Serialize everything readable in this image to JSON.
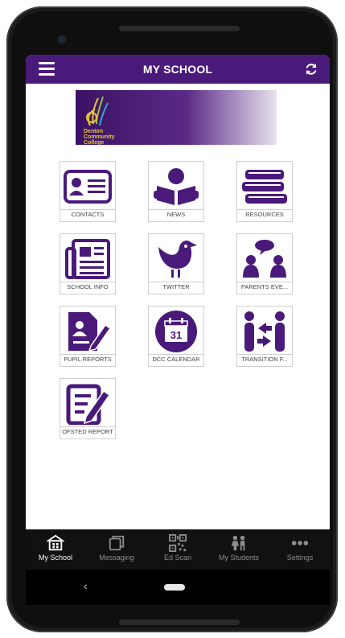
{
  "appbar": {
    "title": "MY SCHOOL"
  },
  "logo": {
    "school_text": "Denton\nCommunity\nCollege"
  },
  "tiles": [
    {
      "label": "CONTACTS",
      "icon": "contact-card-icon"
    },
    {
      "label": "NEWS",
      "icon": "reader-icon"
    },
    {
      "label": "RESOURCES",
      "icon": "books-icon"
    },
    {
      "label": "SCHOOL INFO",
      "icon": "newspaper-icon"
    },
    {
      "label": "TWITTER",
      "icon": "bird-icon"
    },
    {
      "label": "PARENTS EVE...",
      "icon": "parents-meeting-icon"
    },
    {
      "label": "PUPIL REPORTS",
      "icon": "report-document-icon"
    },
    {
      "label": "DCC CALENDAR",
      "icon": "calendar-icon"
    },
    {
      "label": "TRANSITION F...",
      "icon": "transition-icon"
    },
    {
      "label": "OFSTED REPORT",
      "icon": "ofsted-report-icon"
    }
  ],
  "calendar_day": "31",
  "bottom_nav": [
    {
      "label": "My School",
      "icon": "school-icon",
      "active": true
    },
    {
      "label": "Messaging",
      "icon": "messaging-icon",
      "active": false
    },
    {
      "label": "Ed Scan",
      "icon": "qr-code-icon",
      "active": false
    },
    {
      "label": "My Students",
      "icon": "students-icon",
      "active": false
    },
    {
      "label": "Settings",
      "icon": "more-dots-icon",
      "active": false
    }
  ],
  "system_nav": {
    "back_glyph": "‹"
  },
  "colors": {
    "primary": "#4a1a7a",
    "nav_bg": "#111111",
    "accent_yellow": "#e8c53a"
  }
}
